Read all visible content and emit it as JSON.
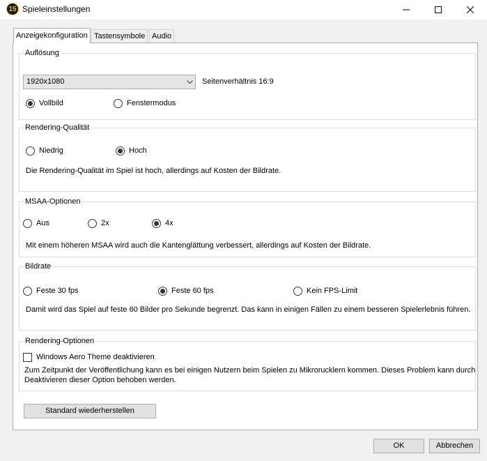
{
  "window": {
    "title": "Spieleinstellungen",
    "icon_text": "15"
  },
  "tabs": [
    {
      "label": "Anzeigekonfiguration"
    },
    {
      "label": "Tastensymbole"
    },
    {
      "label": "Audio"
    }
  ],
  "resolution": {
    "title": "Auflösung",
    "selected": "1920x1080",
    "aspect": "Seitenverhältnis 16:9",
    "options": [
      {
        "label": "Vollbild",
        "checked": true
      },
      {
        "label": "Fenstermodus",
        "checked": false
      }
    ]
  },
  "quality": {
    "title": "Rendering-Qualität",
    "options": [
      {
        "label": "Niedrig",
        "checked": false
      },
      {
        "label": "Hoch",
        "checked": true
      }
    ],
    "description": "Die Rendering-Qualität im Spiel ist hoch, allerdings auf Kosten der Bildrate."
  },
  "msaa": {
    "title": "MSAA-Optionen",
    "options": [
      {
        "label": "Aus",
        "checked": false
      },
      {
        "label": "2x",
        "checked": false
      },
      {
        "label": "4x",
        "checked": true
      }
    ],
    "description": "Mit einem höheren MSAA wird auch die Kantenglättung verbessert, allerdings auf Kosten der Bildrate."
  },
  "framerate": {
    "title": "Bildrate",
    "options": [
      {
        "label": "Feste 30 fps",
        "checked": false
      },
      {
        "label": "Feste 60 fps",
        "checked": true
      },
      {
        "label": "Kein FPS-Limit",
        "checked": false
      }
    ],
    "description": "Damit wird das Spiel auf feste 60 Bilder pro Sekunde begrenzt. Das kann in einigen Fällen zu einem besseren Spielerlebnis führen."
  },
  "render_options": {
    "title": "Rendering-Optionen",
    "checkbox_label": "Windows Aero Theme deaktivieren",
    "checked": false,
    "description_line1": "Zum Zeitpunkt der Veröffentlichung kann es bei einigen Nutzern beim Spielen zu Mikrorucklern kommen. Dieses Problem kann durch",
    "description_line2": "Deaktivieren dieser Option behoben werden."
  },
  "buttons": {
    "restore": "Standard wiederherstellen",
    "ok": "OK",
    "cancel": "Abbrechen"
  }
}
